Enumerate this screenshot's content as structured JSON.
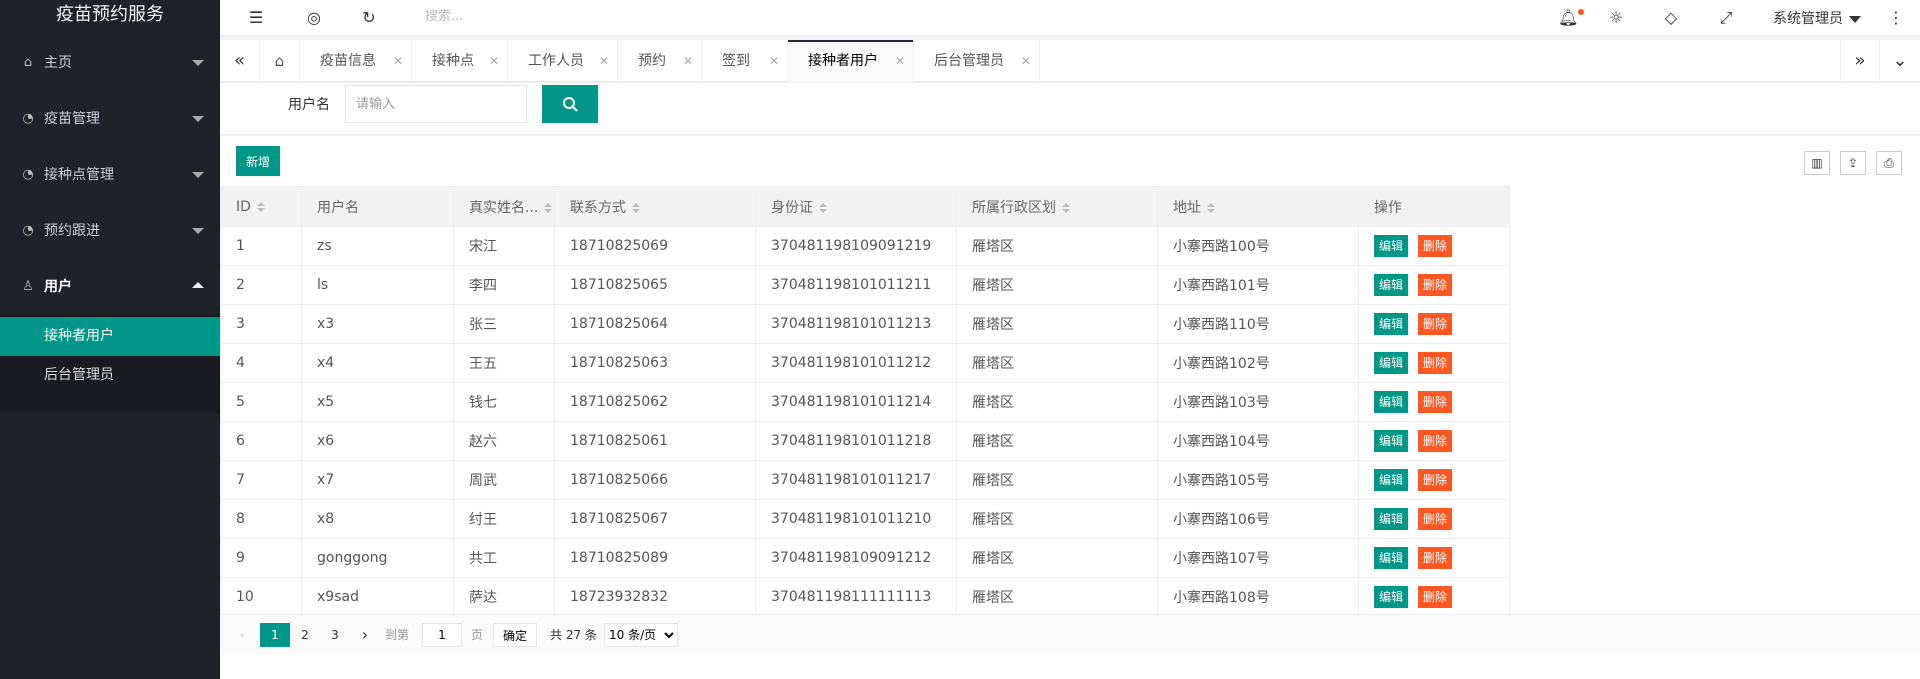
{
  "app": {
    "title": "疫苗预约服务"
  },
  "sidebar": {
    "items": [
      {
        "label": "主页",
        "icon": "home-icon"
      },
      {
        "label": "疫苗管理",
        "icon": "dashboard-icon"
      },
      {
        "label": "接种点管理",
        "icon": "dashboard-icon"
      },
      {
        "label": "预约跟进",
        "icon": "dashboard-icon"
      },
      {
        "label": "用户",
        "icon": "user-icon"
      }
    ],
    "subitems": [
      {
        "label": "接种者用户"
      },
      {
        "label": "后台管理员"
      }
    ]
  },
  "header": {
    "search_placeholder": "搜索...",
    "user": "系统管理员"
  },
  "tabs": {
    "items": [
      {
        "label": "疫苗信息"
      },
      {
        "label": "接种点"
      },
      {
        "label": "工作人员"
      },
      {
        "label": "预约"
      },
      {
        "label": "签到"
      },
      {
        "label": "接种者用户"
      },
      {
        "label": "后台管理员"
      }
    ],
    "active": "接种者用户"
  },
  "search": {
    "label": "用户名",
    "placeholder": "请输入"
  },
  "toolbar": {
    "add_label": "新增"
  },
  "table": {
    "columns": [
      "ID",
      "用户名",
      "真实姓名...",
      "联系方式",
      "身份证",
      "所属行政区划",
      "地址",
      "操作"
    ],
    "edit_label": "编辑",
    "delete_label": "删除",
    "rows": [
      [
        "1",
        "zs",
        "宋江",
        "18710825069",
        "370481198109091219",
        "雁塔区",
        "小寨西路100号"
      ],
      [
        "2",
        "ls",
        "李四",
        "18710825065",
        "370481198101011211",
        "雁塔区",
        "小寨西路101号"
      ],
      [
        "3",
        "x3",
        "张三",
        "18710825064",
        "370481198101011213",
        "雁塔区",
        "小寨西路110号"
      ],
      [
        "4",
        "x4",
        "王五",
        "18710825063",
        "370481198101011212",
        "雁塔区",
        "小寨西路102号"
      ],
      [
        "5",
        "x5",
        "钱七",
        "18710825062",
        "370481198101011214",
        "雁塔区",
        "小寨西路103号"
      ],
      [
        "6",
        "x6",
        "赵六",
        "18710825061",
        "370481198101011218",
        "雁塔区",
        "小寨西路104号"
      ],
      [
        "7",
        "x7",
        "周武",
        "18710825066",
        "370481198101011217",
        "雁塔区",
        "小寨西路105号"
      ],
      [
        "8",
        "x8",
        "纣王",
        "18710825067",
        "370481198101011210",
        "雁塔区",
        "小寨西路106号"
      ],
      [
        "9",
        "gonggong",
        "共工",
        "18710825089",
        "370481198109091212",
        "雁塔区",
        "小寨西路107号"
      ],
      [
        "10",
        "x9sad",
        "萨达",
        "18723932832",
        "370481198111111113",
        "雁塔区",
        "小寨西路108号"
      ]
    ]
  },
  "pager": {
    "pages": [
      "1",
      "2",
      "3"
    ],
    "current": "1",
    "goto_label": "到第",
    "goto_value": "1",
    "page_suffix": "页",
    "ok_label": "确定",
    "total": "共 27 条",
    "page_size": "10 条/页"
  }
}
